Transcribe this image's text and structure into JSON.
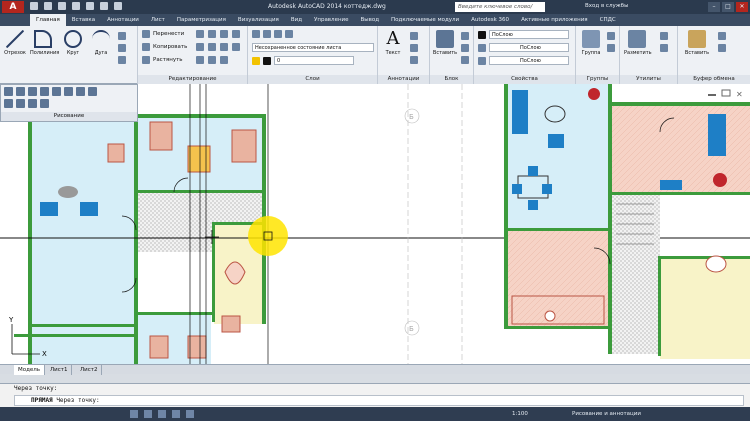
{
  "window": {
    "app_letter": "A",
    "title": "Autodesk AutoCAD 2014   коттедж.dwg",
    "search_placeholder": "Введите ключевое слово/фразу",
    "sign_in": "Вход в службы"
  },
  "ribbon_tabs": [
    "Главная",
    "Вставка",
    "Аннотации",
    "Лист",
    "Параметризация",
    "Визуализация",
    "Вид",
    "Управление",
    "Вывод",
    "Подключаемые модули",
    "Autodesk 360",
    "Активные приложения",
    "СПДС"
  ],
  "ribbon": {
    "draw": {
      "otrezok": "Отрезок",
      "polyline": "Полилиния",
      "circle": "Круг",
      "arc": "Дуга"
    },
    "modify": {
      "title": "Редактирование",
      "move": "Перенести",
      "copy": "Копировать",
      "stretch": "Растянуть"
    },
    "layers": {
      "title": "Слои",
      "state_combo": "Несохраненное состояние листа",
      "layer_value": "0"
    },
    "annotation": {
      "title": "Аннотации",
      "text": "Текст"
    },
    "block": {
      "title": "Блок",
      "insert": "Вставить"
    },
    "properties": {
      "title": "Свойства",
      "color": "ПоСлою",
      "linetype": "ПоСлою",
      "lineweight": "ПоСлою"
    },
    "groups": {
      "title": "Группы",
      "group": "Группа"
    },
    "utilities": {
      "title": "Утилиты",
      "measure": "Разметить"
    },
    "clipboard": {
      "title": "Буфер обмена",
      "paste": "Вставить"
    }
  },
  "draw_palette": {
    "title": "Рисование"
  },
  "drawing": {
    "axis_marks": [
      "Б",
      "Б"
    ],
    "ucs_x": "X",
    "ucs_y": "Y"
  },
  "model_tabs": [
    "Модель",
    "Лист1",
    "Лист2"
  ],
  "command": {
    "history": "Через точку:",
    "prompt_keyword": "ПРЯМАЯ",
    "prompt_text": "Через точку:"
  },
  "status": {
    "scale": "1:100",
    "workspace": "Рисование и аннотации"
  },
  "colors": {
    "wall_green": "#3c9b3c",
    "room_blue": "#d6eef8",
    "room_yellow": "#f8f3c8",
    "room_pink": "#f6d3c6",
    "cursor_highlight": "#ffe400"
  }
}
